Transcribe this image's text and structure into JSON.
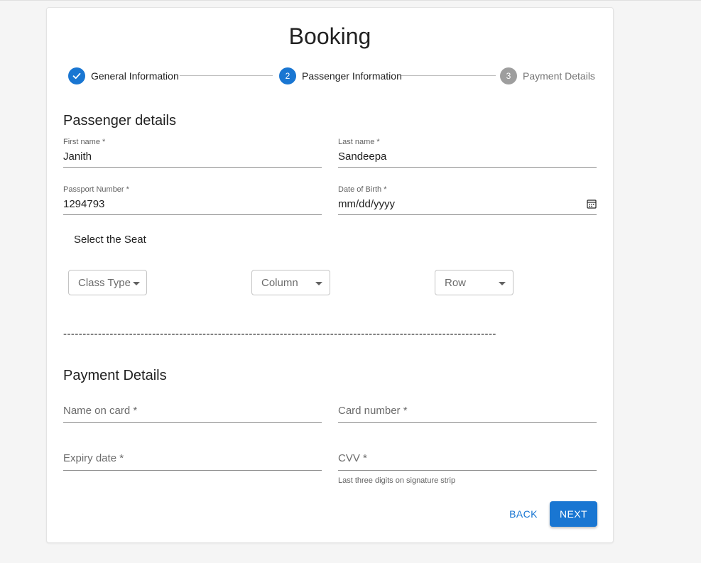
{
  "page": {
    "title": "Booking"
  },
  "stepper": {
    "steps": [
      {
        "label": "General Information",
        "state": "completed",
        "icon": "check-icon",
        "number": "1"
      },
      {
        "label": "Passenger Information",
        "state": "active",
        "number": "2"
      },
      {
        "label": "Payment Details",
        "state": "pending",
        "number": "3"
      }
    ]
  },
  "passenger": {
    "section_title": "Passenger details",
    "first_name": {
      "label": "First name *",
      "value": "Janith"
    },
    "last_name": {
      "label": "Last name *",
      "value": "Sandeepa"
    },
    "passport": {
      "label": "Passport Number *",
      "value": "1294793"
    },
    "dob": {
      "label": "Date of Birth *",
      "value": "mm/dd/yyyy",
      "icon": "calendar-icon"
    }
  },
  "seat": {
    "label": "Select the Seat",
    "class_type": "Class Type",
    "column": "Column",
    "row": "Row"
  },
  "divider": "----------------------------------------------------------------------------------------------------------------",
  "payment": {
    "section_title": "Payment Details",
    "name_on_card": "Name on card *",
    "card_number": "Card number *",
    "expiry_date": "Expiry date *",
    "cvv": "CVV *",
    "cvv_helper": "Last three digits on signature strip"
  },
  "actions": {
    "back": "BACK",
    "next": "NEXT"
  },
  "colors": {
    "primary": "#1976d2",
    "pending": "#9e9e9e"
  }
}
